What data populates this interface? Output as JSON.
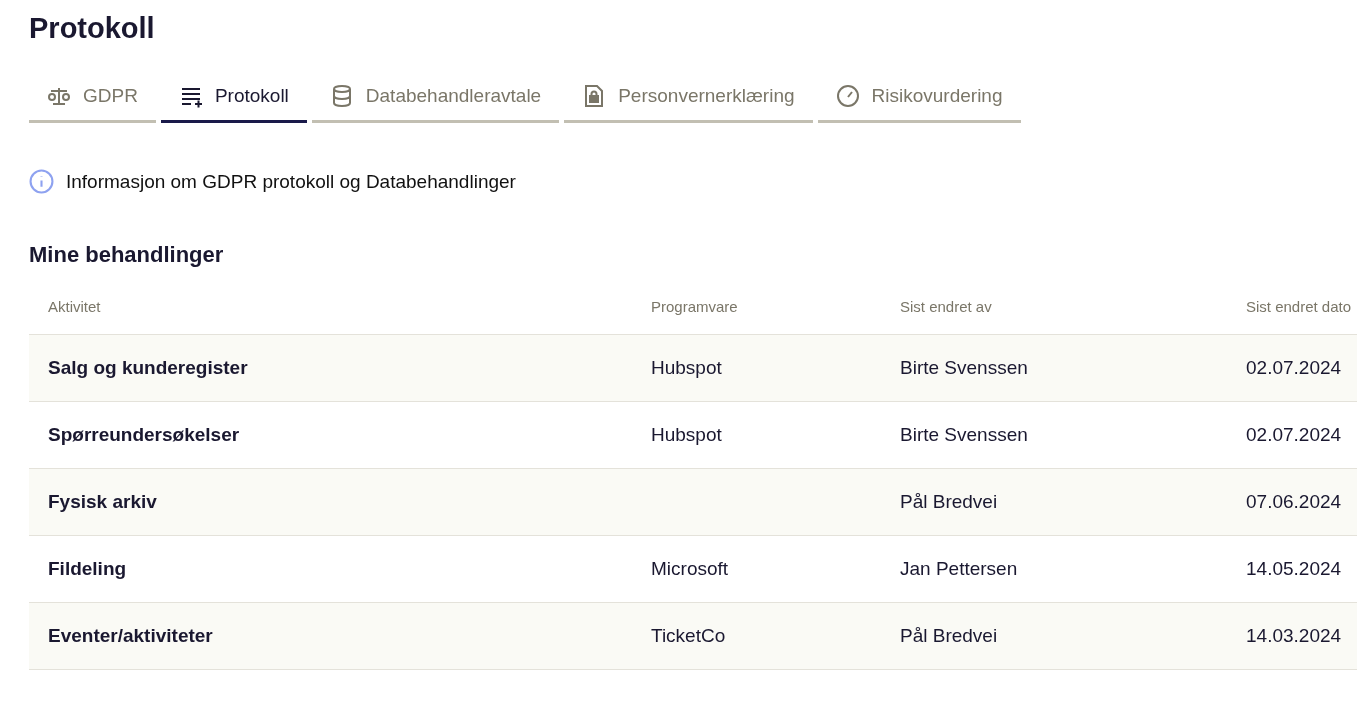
{
  "page_title": "Protokoll",
  "tabs": [
    {
      "label": "GDPR",
      "kind": "scale",
      "selected": false
    },
    {
      "label": "Protokoll",
      "kind": "list",
      "selected": true
    },
    {
      "label": "Databehandleravtale",
      "kind": "database",
      "selected": false
    },
    {
      "label": "Personvernerklæring",
      "kind": "lock",
      "selected": false
    },
    {
      "label": "Risikovurdering",
      "kind": "gauge",
      "selected": false
    }
  ],
  "info_link": "Informasjon om GDPR protokoll og Databehandlinger",
  "section_title": "Mine behandlinger",
  "table": {
    "columns": [
      "Aktivitet",
      "Programvare",
      "Sist endret av",
      "Sist endret dato"
    ],
    "rows": [
      {
        "activity": "Salg og kunderegister",
        "software": "Hubspot",
        "changed_by": "Birte Svenssen",
        "date": "02.07.2024"
      },
      {
        "activity": "Spørreundersøkelser",
        "software": "Hubspot",
        "changed_by": "Birte Svenssen",
        "date": "02.07.2024"
      },
      {
        "activity": "Fysisk arkiv",
        "changed_by": "Pål Bredvei",
        "date": "07.06.2024"
      },
      {
        "activity": "Fildeling",
        "software": "Microsoft",
        "changed_by": "Jan Pettersen",
        "date": "14.05.2024"
      },
      {
        "activity": "Eventer/aktiviteter",
        "software": "TicketCo",
        "changed_by": "Pål Bredvei",
        "date": "14.03.2024"
      }
    ]
  }
}
